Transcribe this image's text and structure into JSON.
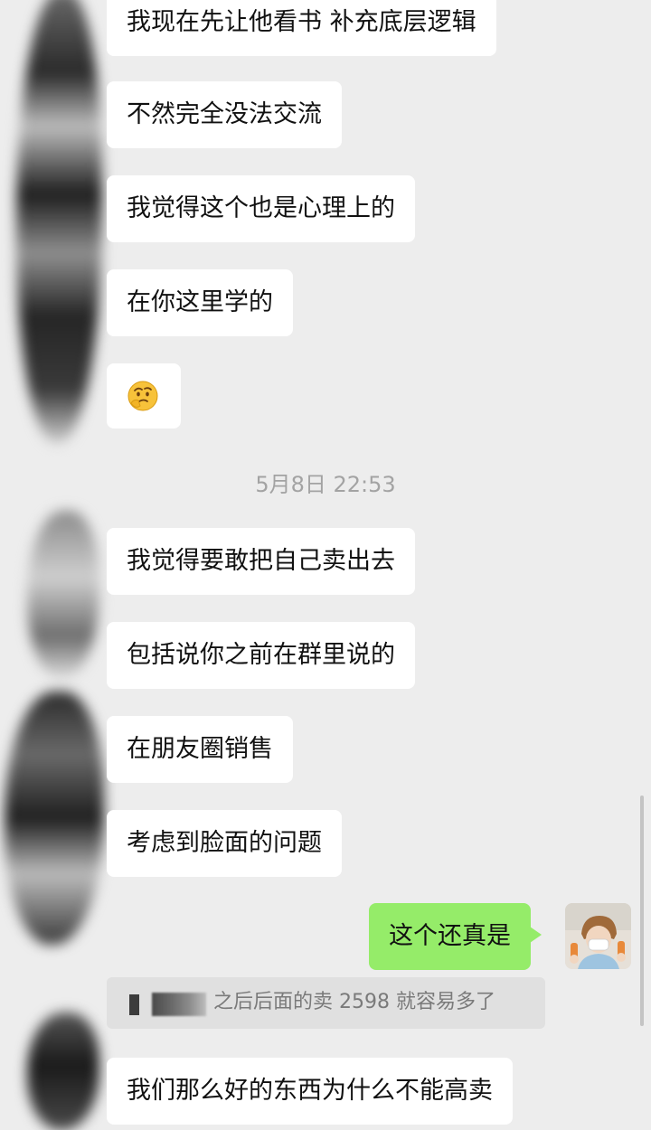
{
  "messages": {
    "m1": "我现在先让他看书 补充底层逻辑",
    "m2": "不然完全没法交流",
    "m3": "我觉得这个也是心理上的",
    "m4": "在你这里学的",
    "m5_icon": "thinking-face-emoji",
    "timestamp": "5月8日 22:53",
    "m6": "我觉得要敢把自己卖出去",
    "m7": "包括说你之前在群里说的",
    "m8": "在朋友圈销售",
    "m9": "考虑到脸面的问题",
    "m10_outgoing": "这个还真是",
    "quote_text": "之后后面的卖 2598 就容易多了",
    "m11": "我们那么好的东西为什么不能高卖"
  },
  "colors": {
    "background": "#ededed",
    "incoming_bubble": "#ffffff",
    "outgoing_bubble": "#95ec69",
    "timestamp": "#a3a3a3"
  }
}
